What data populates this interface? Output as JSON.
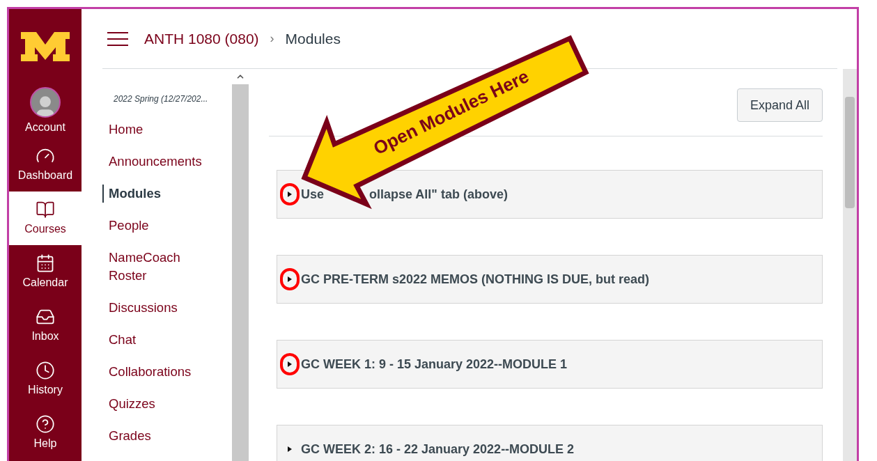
{
  "global_nav": [
    {
      "kind": "account",
      "label": "Account",
      "selected": false
    },
    {
      "kind": "dashboard",
      "label": "Dashboard",
      "selected": false
    },
    {
      "kind": "courses",
      "label": "Courses",
      "selected": true
    },
    {
      "kind": "calendar",
      "label": "Calendar",
      "selected": false
    },
    {
      "kind": "inbox",
      "label": "Inbox",
      "selected": false
    },
    {
      "kind": "history",
      "label": "History",
      "selected": false
    },
    {
      "kind": "help",
      "label": "Help",
      "selected": false
    }
  ],
  "breadcrumb": [
    "ANTH 1080 (080)",
    "Modules"
  ],
  "breadcrumb_separator": "›",
  "course_nav": {
    "term": "2022 Spring (12/27/202...",
    "items": [
      {
        "label": "Home",
        "selected": false
      },
      {
        "label": "Announcements",
        "selected": false
      },
      {
        "label": "Modules",
        "selected": true
      },
      {
        "label": "People",
        "selected": false
      },
      {
        "label": "NameCoach Roster",
        "selected": false
      },
      {
        "label": "Discussions",
        "selected": false
      },
      {
        "label": "Chat",
        "selected": false
      },
      {
        "label": "Collaborations",
        "selected": false
      },
      {
        "label": "Quizzes",
        "selected": false
      },
      {
        "label": "Grades",
        "selected": false
      }
    ]
  },
  "expand_all_button": "Expand All",
  "modules": [
    {
      "title_parts": [
        "Use",
        "ollapse All\" tab (above)"
      ],
      "circled": true
    },
    {
      "title_parts": [
        "GC PRE-TERM s2022 MEMOS (NOTHING IS DUE, but read)"
      ],
      "circled": true
    },
    {
      "title_parts": [
        "GC WEEK 1: 9 - 15 January 2022--MODULE 1"
      ],
      "circled": true
    },
    {
      "title_parts": [
        "GC WEEK 2: 16 - 22 January 2022--MODULE 2"
      ],
      "circled": false
    }
  ],
  "annotation": {
    "label": "Open Modules Here"
  }
}
